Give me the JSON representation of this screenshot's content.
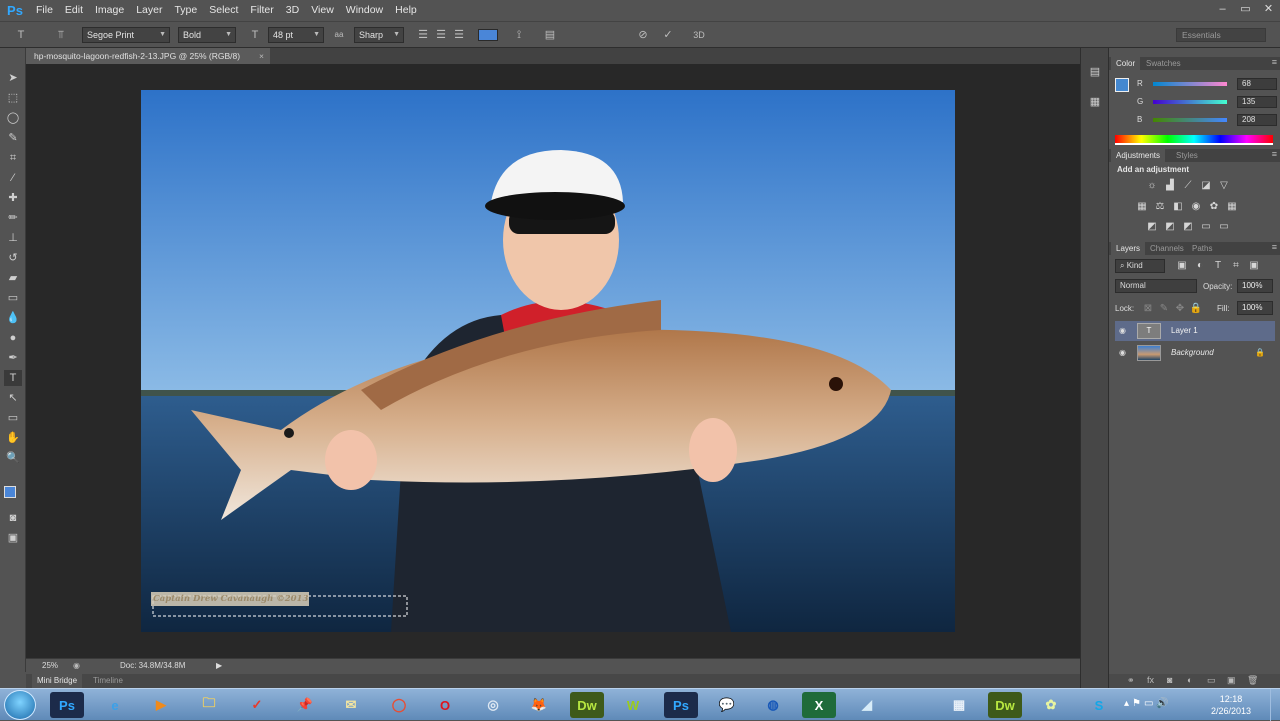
{
  "app": {
    "logo": "Ps"
  },
  "menu": [
    "File",
    "Edit",
    "Image",
    "Layer",
    "Type",
    "Select",
    "Filter",
    "3D",
    "View",
    "Window",
    "Help"
  ],
  "window_controls": [
    "–",
    "▭",
    "✕"
  ],
  "options_bar": {
    "font_family": "Segoe Print",
    "font_style": "Bold",
    "font_size": "48 pt",
    "anti_alias_label": "aa",
    "anti_alias": "Sharp",
    "text_color": "#4a86d8",
    "workspace": "Essentials"
  },
  "document": {
    "tab_title": "hp-mosquito-lagoon-redfish-2-13.JPG @ 25% (RGB/8)",
    "watermark_text": "Captain Drew Cavanaugh ©2013"
  },
  "status": {
    "zoom": "25%",
    "doc_size": "Doc: 34.8M/34.8M"
  },
  "bottom_tabs": [
    "Mini Bridge",
    "Timeline"
  ],
  "color_panel": {
    "tabs": [
      "Color",
      "Swatches"
    ],
    "r": {
      "label": "R",
      "value": "68"
    },
    "g": {
      "label": "G",
      "value": "135"
    },
    "b": {
      "label": "B",
      "value": "208"
    }
  },
  "adjustments_panel": {
    "tabs": [
      "Adjustments",
      "Styles"
    ],
    "heading": "Add an adjustment"
  },
  "layers_panel": {
    "tabs": [
      "Layers",
      "Channels",
      "Paths"
    ],
    "filter_kind": "Kind",
    "blend_mode": "Normal",
    "opacity_label": "Opacity:",
    "opacity": "100%",
    "lock_label": "Lock:",
    "fill_label": "Fill:",
    "fill": "100%",
    "layers": [
      {
        "name": "Layer 1",
        "selected": true
      },
      {
        "name": "Background",
        "selected": false
      }
    ]
  },
  "taskbar": {
    "icons": [
      "Ps",
      "e",
      "▶",
      "🗀",
      "✓",
      "📌",
      "✉",
      "◯",
      "O",
      "◎",
      "🦊",
      "Dw",
      "W",
      "Ps",
      "💬",
      "◍",
      "X",
      "◢",
      "▦",
      "Dw",
      "✿",
      "S"
    ],
    "time": "12:18",
    "date": "2/26/2013"
  }
}
